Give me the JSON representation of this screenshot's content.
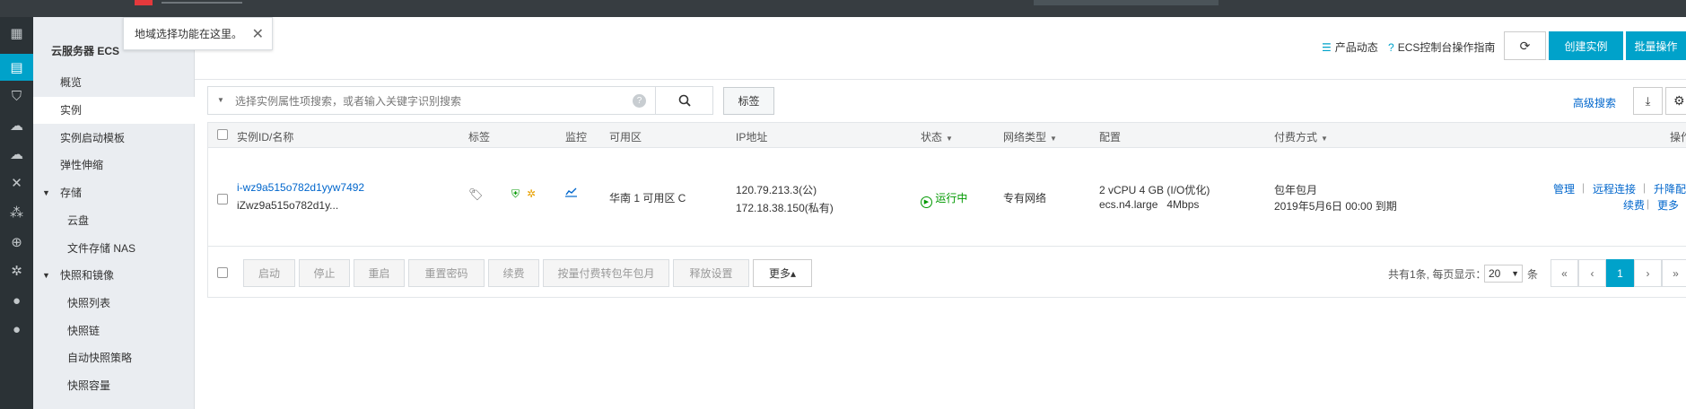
{
  "sidebar": {
    "title": "云服务器 ECS",
    "items": {
      "overview": "概览",
      "instances": "实例",
      "launch_templates": "实例启动模板",
      "autoscaling": "弹性伸缩",
      "storage_group": "存储",
      "disks": "云盘",
      "nas": "文件存储 NAS",
      "snapshot_group": "快照和镜像",
      "snapshot_list": "快照列表",
      "snapshot_chain": "快照链",
      "auto_snapshot": "自动快照策略",
      "snapshot_capacity": "快照容量"
    }
  },
  "tooltip": {
    "text": "地域选择功能在这里。",
    "close": "✕"
  },
  "header": {
    "product_news": "产品动态",
    "guide": "ECS控制台操作指南",
    "create_instance": "创建实例",
    "batch_ops": "批量操作"
  },
  "search": {
    "placeholder": "选择实例属性项搜索，或者输入关键字识别搜索",
    "tag_button": "标签",
    "advanced": "高级搜索"
  },
  "table": {
    "headers": {
      "id_name": "实例ID/名称",
      "tags": "标签",
      "monitor": "监控",
      "zone": "可用区",
      "ip": "IP地址",
      "status": "状态",
      "network": "网络类型",
      "config": "配置",
      "billing": "付费方式",
      "actions": "操作"
    },
    "row": {
      "id": "i-wz9a515o782d1yyw7492",
      "name": "iZwz9a515o782d1y...",
      "zone": "华南 1 可用区 C",
      "ip_public": "120.79.213.3(公)",
      "ip_private": "172.18.38.150(私有)",
      "status": "运行中",
      "network": "专有网络",
      "config_line1": "2 vCPU 4 GB (I/O优化)",
      "config_line2": "ecs.n4.large   4Mbps",
      "billing_line1": "包年包月",
      "billing_line2": "2019年5月6日 00:00 到期",
      "action_manage": "管理",
      "action_remote": "远程连接",
      "action_upgrade": "升降配",
      "action_renew": "续费",
      "action_more": "更多"
    }
  },
  "footer": {
    "buttons": {
      "start": "启动",
      "stop": "停止",
      "restart": "重启",
      "reset_pwd": "重置密码",
      "renew": "续费",
      "convert": "按量付费转包年包月",
      "release": "释放设置",
      "more": "更多▴"
    },
    "pagination": {
      "total": "共有1条, 每页显示：",
      "page_size": "20",
      "unit": "条",
      "first": "«",
      "prev": "‹",
      "current": "1",
      "next": "›",
      "last": "»"
    }
  },
  "colors": {
    "accent": "#00a2ca",
    "link": "#0066cc",
    "running": "#009900",
    "topbar": "#373d41",
    "rail": "#2b3236",
    "sidebar": "#eaedf1"
  }
}
